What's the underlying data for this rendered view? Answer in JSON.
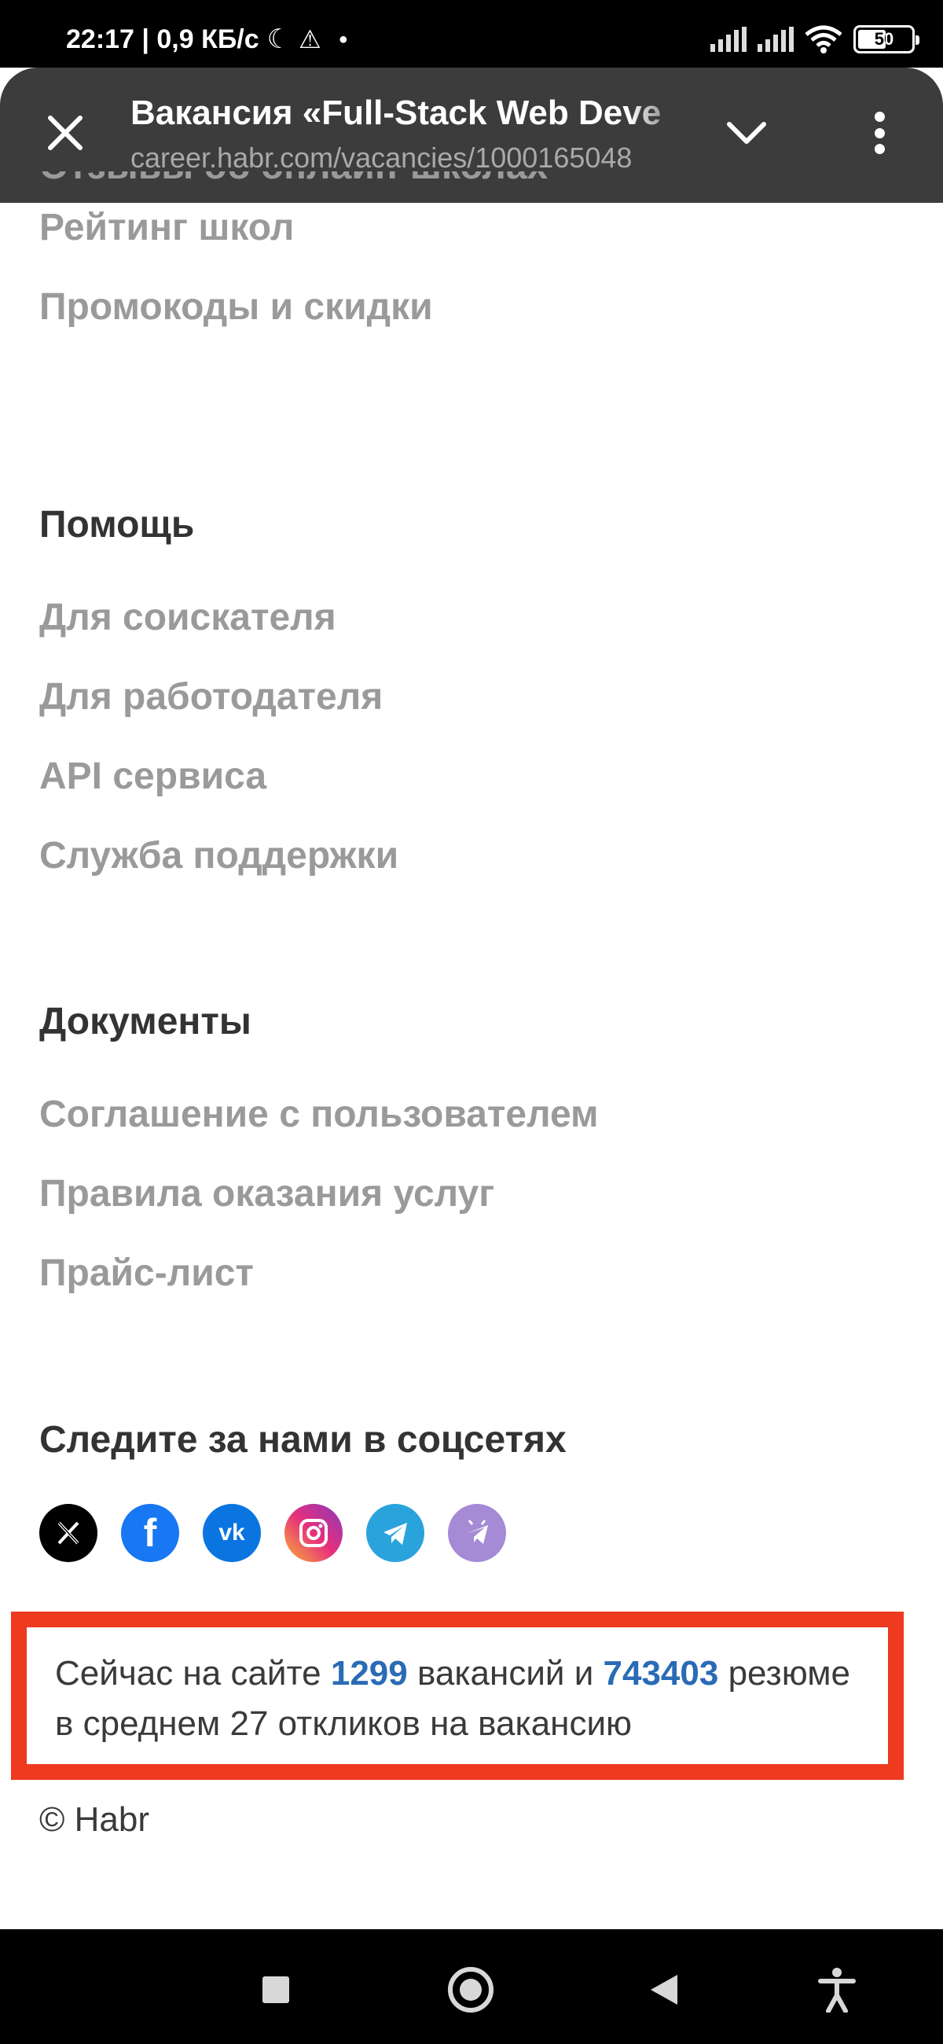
{
  "status_bar": {
    "time_and_speed": "22:17 | 0,9 КБ/с",
    "battery_level": "50"
  },
  "browser": {
    "page_title": "Вакансия «Full-Stack Web Deve",
    "url": "career.habr.com/vacancies/1000165048"
  },
  "footer": {
    "cut_link": "Отзывы об онлайн-школах",
    "schools_links": [
      "Рейтинг школ",
      "Промокоды и скидки"
    ],
    "help": {
      "heading": "Помощь",
      "links": [
        "Для соискателя",
        "Для работодателя",
        "API сервиса",
        "Служба поддержки"
      ]
    },
    "documents": {
      "heading": "Документы",
      "links": [
        "Соглашение с пользователем",
        "Правила оказания услуг",
        "Прайс-лист"
      ]
    },
    "social": {
      "heading": "Следите за нами в соцсетях",
      "icons": [
        "x-icon",
        "facebook-icon",
        "vk-icon",
        "instagram-icon",
        "telegram-icon",
        "telegram-bot-icon"
      ]
    },
    "stats": {
      "prefix": "Сейчас на сайте",
      "vacancies_count": "1299",
      "middle": "вакансий и",
      "resumes_count": "743403",
      "suffix": "резюме",
      "line2": "в среднем 27 откликов на вакансию"
    },
    "copyright": "© Habr"
  },
  "colors": {
    "accent_number": "#2a6bb5",
    "highlight_border": "#ee3a1e",
    "link_grey": "#9a9a9a"
  }
}
